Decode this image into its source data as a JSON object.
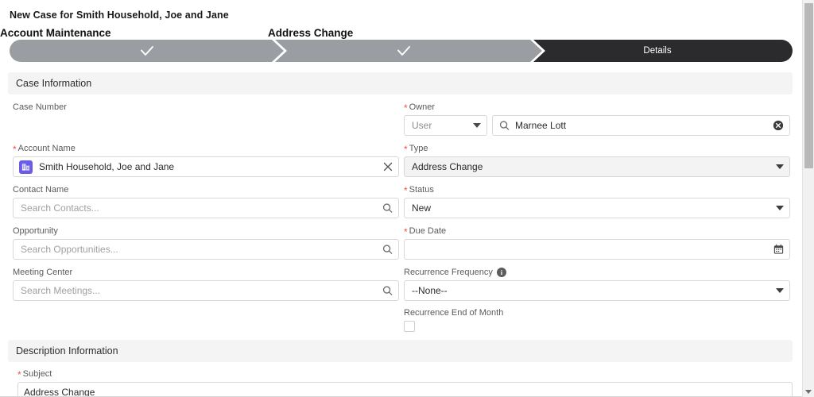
{
  "page": {
    "title": "New Case for Smith Household, Joe and Jane"
  },
  "path_bar": {
    "stage_labels": [
      {
        "text": "Account Maintenance"
      },
      {
        "text": "Address Change"
      }
    ],
    "segments": [
      {
        "label": "",
        "state": "completed",
        "icon": "check-icon",
        "fill": "#9a9ea3"
      },
      {
        "label": "",
        "state": "completed",
        "icon": "check-icon",
        "fill": "#9a9ea3"
      },
      {
        "label": "Details",
        "state": "current",
        "icon": "",
        "fill": "#2b2b2e"
      }
    ]
  },
  "sections": [
    {
      "id": "case-information",
      "title": "Case Information"
    },
    {
      "id": "description-information",
      "title": "Description Information"
    }
  ],
  "fields": {
    "case_number": {
      "label": "Case Number",
      "required": false,
      "value": ""
    },
    "owner": {
      "label": "Owner",
      "required": true,
      "type_value": "User",
      "search_value": "Marnee Lott",
      "lead_icon": "search-icon",
      "clear_icon": "clear-circle-icon",
      "caret_icon": "chevron-down-icon"
    },
    "account_name": {
      "label": "Account Name",
      "required": true,
      "value": "Smith Household, Joe and Jane",
      "entity_icon": "account-icon",
      "clear_icon": "close-x-icon"
    },
    "type": {
      "label": "Type",
      "required": true,
      "value": "Address Change",
      "readonly": true,
      "caret_icon": "chevron-down-icon"
    },
    "contact_name": {
      "label": "Contact Name",
      "required": false,
      "value": "",
      "placeholder": "Search Contacts...",
      "icon": "search-icon"
    },
    "status": {
      "label": "Status",
      "required": true,
      "value": "New",
      "caret_icon": "chevron-down-icon"
    },
    "opportunity": {
      "label": "Opportunity",
      "required": false,
      "value": "",
      "placeholder": "Search Opportunities...",
      "icon": "search-icon"
    },
    "due_date": {
      "label": "Due Date",
      "required": true,
      "value": "",
      "icon": "calendar-icon"
    },
    "meeting_center": {
      "label": "Meeting Center",
      "required": false,
      "value": "",
      "placeholder": "Search Meetings...",
      "icon": "search-icon"
    },
    "recurrence_frequency": {
      "label": "Recurrence Frequency",
      "required": false,
      "value": "--None--",
      "info_icon": "info-icon",
      "info_glyph": "i",
      "caret_icon": "chevron-down-icon"
    },
    "recurrence_end_of_month": {
      "label": "Recurrence End of Month",
      "required": false,
      "checked": false
    },
    "subject": {
      "label": "Subject",
      "required": true,
      "value": "Address Change"
    }
  },
  "scrollbar": {
    "orientation": "vertical",
    "down_arrow_icon": "triangle-down-icon"
  },
  "colors": {
    "accent_purple": "#6b5ce7",
    "required_red": "#e8544b",
    "path_completed": "#9a9ea3",
    "path_current": "#2b2b2e",
    "band_bg": "#f4f4f4"
  }
}
